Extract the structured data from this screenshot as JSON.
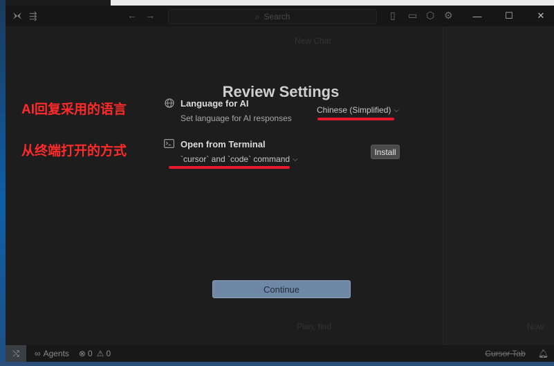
{
  "titlebar": {
    "search_placeholder": "Search",
    "icons": [
      "cursor-logo-icon",
      "sidebar-toggle-icon",
      "back-arrow-icon",
      "forward-arrow-icon",
      "search-icon",
      "layout-panel-icon",
      "layout-bottom-icon",
      "cube-icon",
      "settings-icon"
    ],
    "window_controls": {
      "minimize": "—",
      "maximize": "☐",
      "close": "✕"
    }
  },
  "background": {
    "chat_title": "New Chat",
    "plan_label": "Plan, find",
    "now_label": "Now"
  },
  "dialog": {
    "title": "Review Settings",
    "language": {
      "icon": "globe-icon",
      "title": "Language for AI",
      "subtitle": "Set language for AI responses",
      "value": "Chinese (Simplified)"
    },
    "terminal": {
      "icon": "terminal-icon",
      "title": "Open from Terminal",
      "value": "`cursor` and `code` command",
      "install_label": "Install"
    },
    "continue_label": "Continue"
  },
  "annotations": {
    "language_note": "AI回复采用的语言",
    "terminal_note": "从终端打开的方式",
    "underline_color": "#e8192c"
  },
  "statusbar": {
    "agents_label": "Agents",
    "errors": "0",
    "warnings": "0",
    "cursor_tab_label": "Cursor Tab"
  }
}
